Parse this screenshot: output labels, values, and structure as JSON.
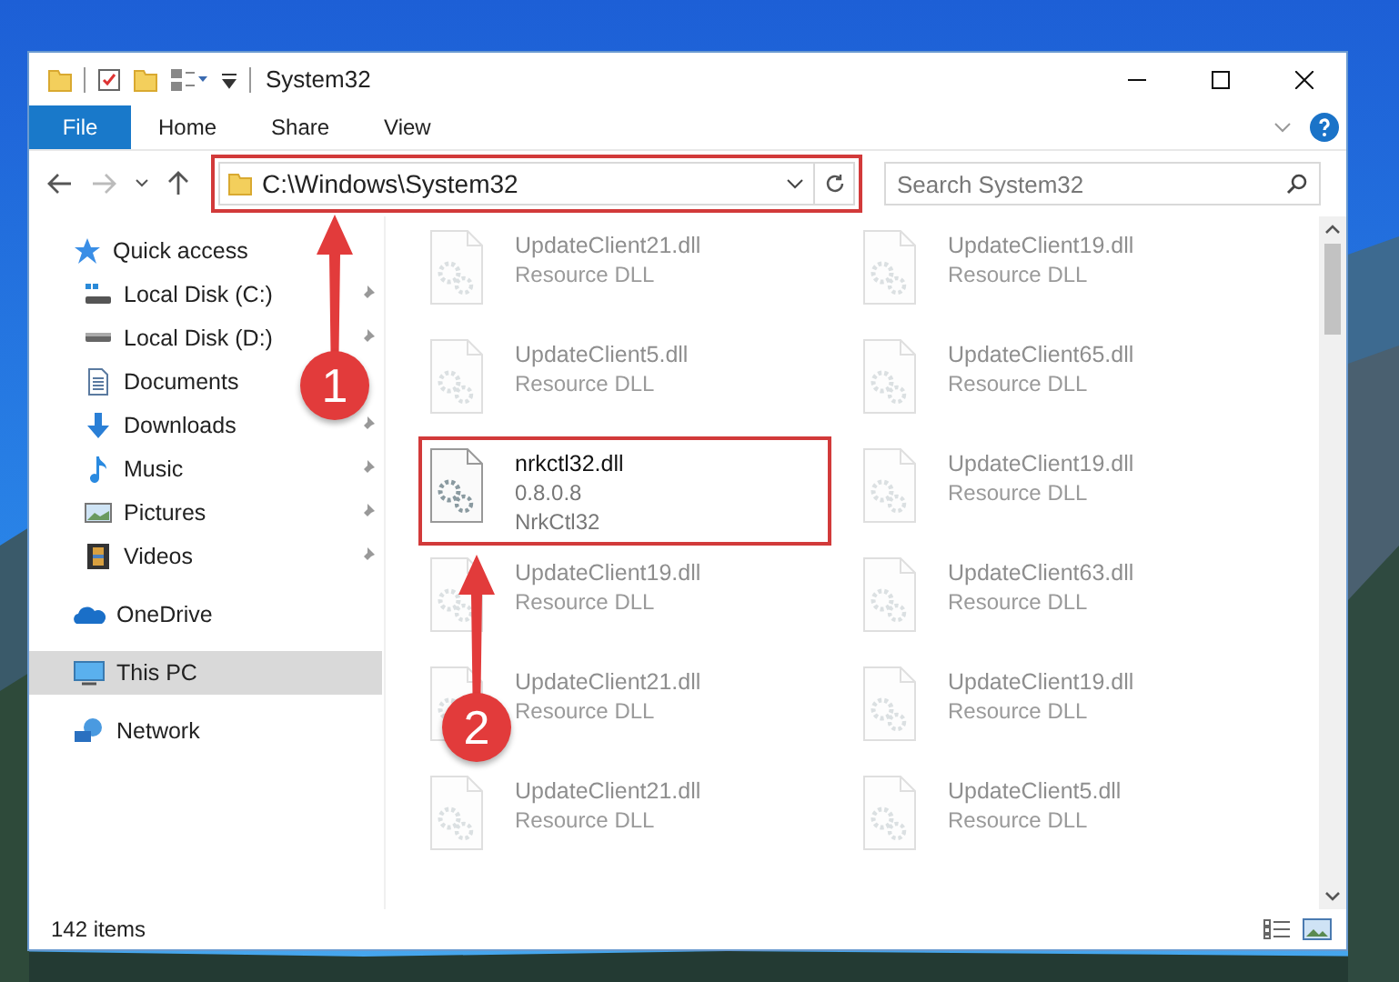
{
  "window": {
    "title": "System32"
  },
  "ribbon_tabs": [
    {
      "label": "File",
      "selected": true
    },
    {
      "label": "Home",
      "selected": false
    },
    {
      "label": "Share",
      "selected": false
    },
    {
      "label": "View",
      "selected": false
    }
  ],
  "address_bar": {
    "path": "C:\\Windows\\System32"
  },
  "search": {
    "placeholder": "Search System32"
  },
  "sidebar": {
    "items": [
      {
        "label": "Quick access",
        "selected": false,
        "children": [
          {
            "label": "Local Disk (C:)",
            "pinned": true
          },
          {
            "label": "Local Disk (D:)",
            "pinned": true
          },
          {
            "label": "Documents",
            "pinned": false
          },
          {
            "label": "Downloads",
            "pinned": true
          },
          {
            "label": "Music",
            "pinned": true
          },
          {
            "label": "Pictures",
            "pinned": true
          },
          {
            "label": "Videos",
            "pinned": true
          }
        ]
      },
      {
        "label": "OneDrive",
        "selected": false
      },
      {
        "label": "This PC",
        "selected": true
      },
      {
        "label": "Network",
        "selected": false
      }
    ]
  },
  "files": [
    {
      "name": "UpdateClient21.dll",
      "details": [
        "Resource DLL"
      ],
      "faded": true
    },
    {
      "name": "UpdateClient19.dll",
      "details": [
        "Resource DLL"
      ],
      "faded": true
    },
    {
      "name": "UpdateClient5.dll",
      "details": [
        "Resource DLL"
      ],
      "faded": true
    },
    {
      "name": "UpdateClient65.dll",
      "details": [
        "Resource DLL"
      ],
      "faded": true
    },
    {
      "name": "nrkctl32.dll",
      "details": [
        "0.8.0.8",
        "NrkCtl32"
      ],
      "faded": false
    },
    {
      "name": "UpdateClient19.dll",
      "details": [
        "Resource DLL"
      ],
      "faded": true
    },
    {
      "name": "UpdateClient19.dll",
      "details": [
        "Resource DLL"
      ],
      "faded": true
    },
    {
      "name": "UpdateClient63.dll",
      "details": [
        "Resource DLL"
      ],
      "faded": true
    },
    {
      "name": "UpdateClient21.dll",
      "details": [
        "Resource DLL"
      ],
      "faded": true
    },
    {
      "name": "UpdateClient19.dll",
      "details": [
        "Resource DLL"
      ],
      "faded": true
    },
    {
      "name": "UpdateClient21.dll",
      "details": [
        "Resource DLL"
      ],
      "faded": true
    },
    {
      "name": "UpdateClient5.dll",
      "details": [
        "Resource DLL"
      ],
      "faded": true
    }
  ],
  "status_bar": {
    "item_count": "142 items"
  },
  "annotations": [
    {
      "kind": "step",
      "label": "1"
    },
    {
      "kind": "step",
      "label": "2"
    }
  ]
}
